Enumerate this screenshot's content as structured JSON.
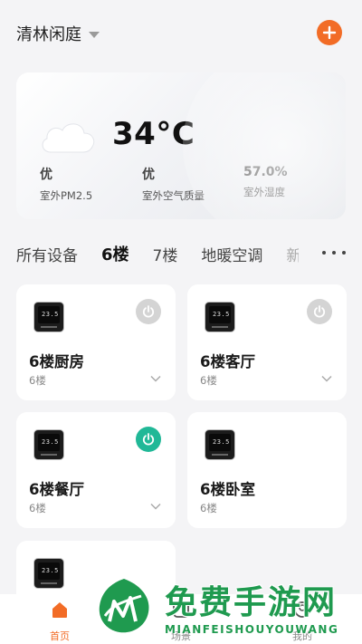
{
  "header": {
    "home_name": "清林闲庭"
  },
  "weather": {
    "temperature": "34°C",
    "icon": "cloud-icon",
    "metrics": [
      {
        "value": "优",
        "label": "室外PM2.5"
      },
      {
        "value": "优",
        "label": "室外空气质量"
      },
      {
        "value": "57.0%",
        "label": "室外湿度"
      }
    ]
  },
  "tabs": [
    "所有设备",
    "6楼",
    "7楼",
    "地暖空调",
    "新"
  ],
  "devices": [
    {
      "name": "6楼厨房",
      "floor": "6楼",
      "display": "23.5",
      "power_on": false,
      "show_power": true
    },
    {
      "name": "6楼客厅",
      "floor": "6楼",
      "display": "23.5",
      "power_on": false,
      "show_power": true
    },
    {
      "name": "6楼餐厅",
      "floor": "6楼",
      "display": "23.5",
      "power_on": true,
      "show_power": true
    },
    {
      "name": "6楼卧室",
      "floor": "6楼",
      "display": "23.5",
      "power_on": false,
      "show_power": false
    },
    {
      "name": "",
      "floor": "",
      "display": "23.5",
      "power_on": false,
      "show_power": false
    }
  ],
  "bottom_nav": [
    {
      "label": "首页",
      "icon": "home-icon",
      "active": true
    },
    {
      "label": "场景",
      "icon": "scene-icon",
      "active": false
    },
    {
      "label": "我的",
      "icon": "profile-icon",
      "active": false
    }
  ],
  "watermark": {
    "title": "免费手游网",
    "subtitle": "MIANFEISHOUYOUWANG"
  },
  "colors": {
    "accent": "#f26c26",
    "power_on": "#20b897",
    "power_off": "#d4d4d4",
    "watermark": "#1f9a4f"
  }
}
